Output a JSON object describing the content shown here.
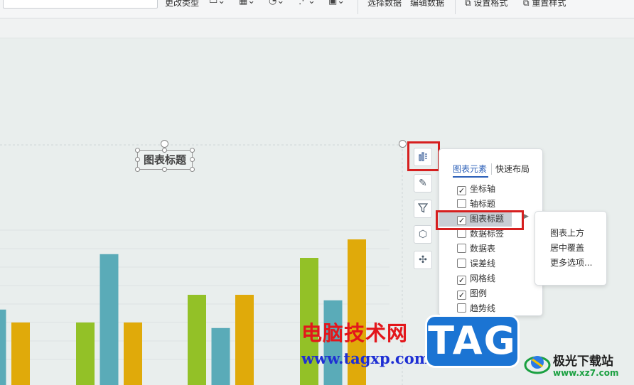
{
  "toolbar": {
    "change_type": "更改类型",
    "select_data": "选择数据",
    "edit_data": "编辑数据",
    "set_format": "设置格式",
    "reset_style": "重置样式"
  },
  "chart": {
    "title": "图表标题"
  },
  "chart_data": {
    "type": "bar",
    "title": "图表标题",
    "xlabel": "",
    "ylabel": "",
    "gridlines": true,
    "series": [
      {
        "color": "#93c127",
        "values": [
          null,
          3.0,
          4.5,
          6.5
        ]
      },
      {
        "color": "#5aabb8",
        "values": [
          3.7,
          6.7,
          2.7,
          4.2
        ]
      },
      {
        "color": "#e0aa0a",
        "values": [
          3.0,
          3.0,
          4.5,
          7.5
        ]
      }
    ],
    "ylim": [
      0,
      8
    ]
  },
  "side_tools": [
    {
      "icon": "chart-elements-icon"
    },
    {
      "icon": "brush-icon"
    },
    {
      "icon": "filter-icon"
    },
    {
      "icon": "settings-hexagon-icon"
    },
    {
      "icon": "magic-tools-icon"
    }
  ],
  "panel": {
    "tabs": [
      "图表元素",
      "快速布局"
    ],
    "options": [
      {
        "label": "坐标轴",
        "checked": true
      },
      {
        "label": "轴标题",
        "checked": false
      },
      {
        "label": "图表标题",
        "checked": true
      },
      {
        "label": "数据标签",
        "checked": false
      },
      {
        "label": "数据表",
        "checked": false
      },
      {
        "label": "误差线",
        "checked": false
      },
      {
        "label": "网格线",
        "checked": true
      },
      {
        "label": "图例",
        "checked": true
      },
      {
        "label": "趋势线",
        "checked": false
      }
    ]
  },
  "submenu": {
    "items": [
      "图表上方",
      "居中覆盖",
      "更多选项..."
    ]
  },
  "watermarks": {
    "site_cn": "电脑技术网",
    "site_url": "www.tagxp.com",
    "tag_logo": "TAG",
    "xz_cn": "极光下载站",
    "xz_url": "www.xz7.com"
  },
  "colors": {
    "highlight_red": "#d61f1f",
    "accent_blue": "#2b5fb8"
  }
}
